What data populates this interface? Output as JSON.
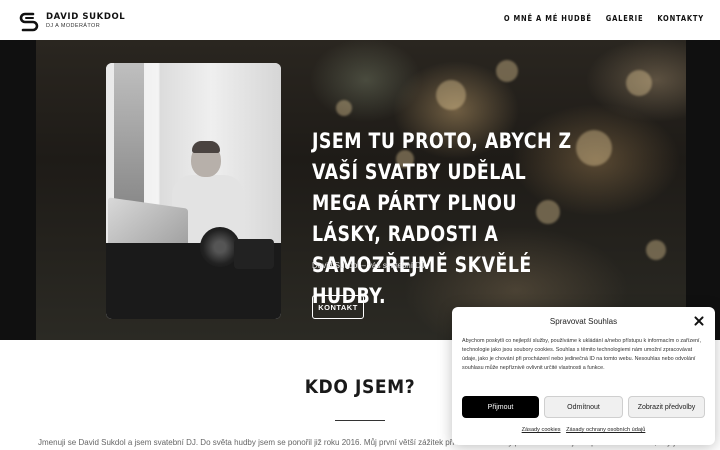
{
  "header": {
    "logo_name": "DAVID SUKDOL",
    "logo_sub": "DJ A MODERÁTOR",
    "nav": [
      "O MNĚ A MÉ HUDBĚ",
      "GALERIE",
      "KONTAKTY"
    ]
  },
  "hero": {
    "title": "JSEM TU PROTO, ABYCH Z VAŠÍ SVATBY UDĚLAL MEGA PÁRTY PLNOU LÁSKY, RADOSTI A SAMOZŘEJMĚ SKVĚLÉ HUDBY.",
    "subtitle": "David Sukdol – váš svatební DJ",
    "button": "KONTAKT"
  },
  "about": {
    "title": "KDO JSEM?",
    "text": "Jmenuji se David Sukdol a jsem svatební DJ. Do světa hudby jsem se ponořil již roku 2016. Můj první větší zážitek při mixování hudby pro širokou veřejnost přišel v roce 2017, kdy jsem se"
  },
  "cookie": {
    "title": "Spravovat Souhlas",
    "text": "Abychom poskytli co nejlepší služby, používáme k ukládání a/nebo přístupu k informacím o zařízení, technologie jako jsou soubory cookies. Souhlas s těmito technologiemi nám umožní zpracovávat údaje, jako je chování při procházení nebo jedinečná ID na tomto webu. Nesouhlas nebo odvolání souhlasu může nepříznivě ovlivnit určité vlastnosti a funkce.",
    "accept": "Přijmout",
    "deny": "Odmítnout",
    "prefs": "Zobrazit předvolby",
    "link_cookies": "Zásady cookies",
    "link_privacy": "Zásady ochrany osobních údajů"
  },
  "colors": {
    "accent": "#000000",
    "hero_text": "#ffffff"
  }
}
